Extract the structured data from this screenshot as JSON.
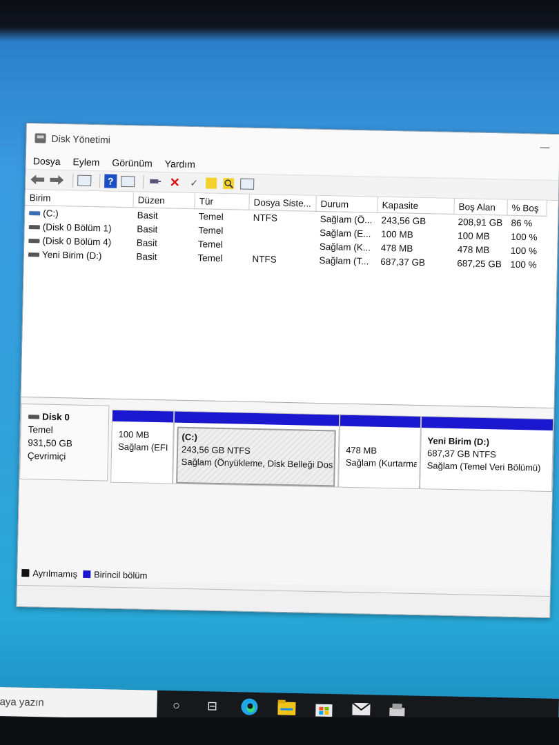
{
  "window": {
    "title": "Disk Yönetimi",
    "minimize": "—"
  },
  "menu": [
    "Dosya",
    "Eylem",
    "Görünüm",
    "Yardım"
  ],
  "toolbar": {
    "icons": [
      "back-arrow-icon",
      "forward-arrow-icon",
      "properties-icon",
      "help-icon",
      "console-icon",
      "connect-icon",
      "delete-icon",
      "check-icon",
      "import-icon",
      "search-icon",
      "details-icon"
    ],
    "help_glyph": "?",
    "delete_glyph": "✕",
    "check_glyph": "✓",
    "search_glyph": "🔍"
  },
  "volume_table": {
    "headers": [
      "Birim",
      "Düzen",
      "Tür",
      "Dosya Siste...",
      "Durum",
      "Kapasite",
      "Boş Alan",
      "% Boş"
    ],
    "rows": [
      [
        "(C:)",
        "Basit",
        "Temel",
        "NTFS",
        "Sağlam (Ö...",
        "243,56 GB",
        "208,91 GB",
        "86 %"
      ],
      [
        "(Disk 0 Bölüm 1)",
        "Basit",
        "Temel",
        "",
        "Sağlam (E...",
        "100 MB",
        "100 MB",
        "100 %"
      ],
      [
        "(Disk 0 Bölüm 4)",
        "Basit",
        "Temel",
        "",
        "Sağlam (K...",
        "478 MB",
        "478 MB",
        "100 %"
      ],
      [
        "Yeni Birim (D:)",
        "Basit",
        "Temel",
        "NTFS",
        "Sağlam (T...",
        "687,37 GB",
        "687,25 GB",
        "100 %"
      ]
    ]
  },
  "disk": {
    "name": "Disk 0",
    "type": "Temel",
    "size": "931,50 GB",
    "status": "Çevrimiçi"
  },
  "partitions": [
    {
      "title": "",
      "line1": "100 MB",
      "line2": "Sağlam (EFI"
    },
    {
      "title": "(C:)",
      "line1": "243,56 GB NTFS",
      "line2": "Sağlam (Önyükleme, Disk Belleği Dos"
    },
    {
      "title": "",
      "line1": "478 MB",
      "line2": "Sağlam (Kurtarma"
    },
    {
      "title": "Yeni Birim  (D:)",
      "line1": "687,37 GB NTFS",
      "line2": "Sağlam (Temel Veri Bölümü)"
    }
  ],
  "legend": [
    {
      "label": "Ayrılmamış",
      "color": "#111111"
    },
    {
      "label": "Birincil bölüm",
      "color": "#1a17cf"
    }
  ],
  "taskbar": {
    "search_text": "aya yazın",
    "icons": [
      "task-view-circle-icon",
      "timeline-icon",
      "edge-icon",
      "file-explorer-icon",
      "store-icon",
      "mail-icon",
      "disk-management-icon"
    ],
    "circle_glyph": "○",
    "timeline_glyph": "⊟"
  },
  "colors": {
    "primary_partition": "#1a17cf",
    "edge": "#1fa6e8",
    "explorer": "#f0c419"
  }
}
